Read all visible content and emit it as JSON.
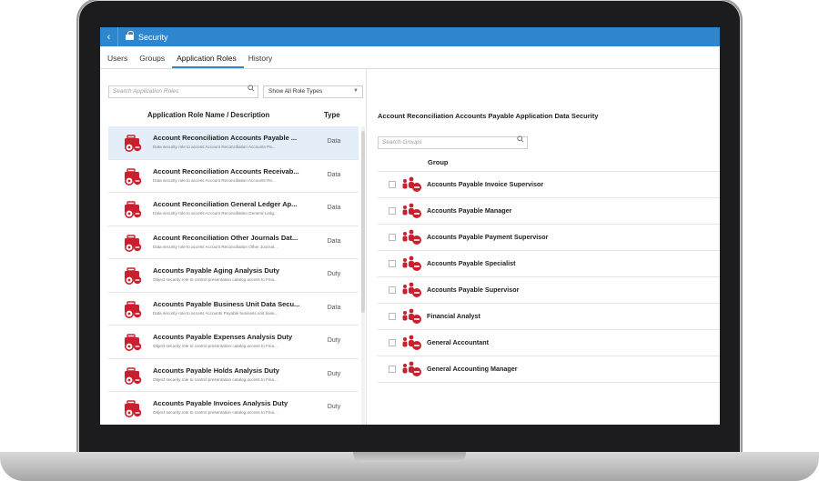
{
  "header": {
    "title": "Security",
    "back_glyph": "‹"
  },
  "tabs": [
    {
      "label": "Users",
      "active": false
    },
    {
      "label": "Groups",
      "active": false
    },
    {
      "label": "Application Roles",
      "active": true
    },
    {
      "label": "History",
      "active": false
    }
  ],
  "left_panel": {
    "search_placeholder": "Search Application Roles",
    "filter_value": "Show All Role Types",
    "columns": {
      "name": "Application Role Name / Description",
      "type": "Type"
    },
    "roles": [
      {
        "name": "Account Reconciliation Accounts Payable ...",
        "desc": "Data security role to access Account Reconciliation Accounts Pa...",
        "type": "Data",
        "selected": true
      },
      {
        "name": "Account Reconciliation Accounts Receivab...",
        "desc": "Data security role to access Account Reconciliation Accounts Re...",
        "type": "Data",
        "selected": false
      },
      {
        "name": "Account Reconciliation General Ledger Ap...",
        "desc": "Data security role to access Account Reconciliation General Ledg...",
        "type": "Data",
        "selected": false
      },
      {
        "name": "Account Reconciliation Other Journals Dat...",
        "desc": "Data security role to access Account Reconciliation Other Journal...",
        "type": "Data",
        "selected": false
      },
      {
        "name": "Accounts Payable Aging Analysis Duty",
        "desc": "Object security role to control presentation catalog access to Fina...",
        "type": "Duty",
        "selected": false
      },
      {
        "name": "Accounts Payable Business Unit Data Secu...",
        "desc": "Data security role to access Accounts Payable business unit base...",
        "type": "Data",
        "selected": false
      },
      {
        "name": "Accounts Payable Expenses Analysis Duty",
        "desc": "Object security role to control presentation catalog access to Fina...",
        "type": "Duty",
        "selected": false
      },
      {
        "name": "Accounts Payable Holds Analysis Duty",
        "desc": "Object security role to control presentation catalog access to Fina...",
        "type": "Duty",
        "selected": false
      },
      {
        "name": "Accounts Payable Invoices Analysis Duty",
        "desc": "Object security role to control presentation catalog access to Fina...",
        "type": "Duty",
        "selected": false
      }
    ]
  },
  "right_panel": {
    "title": "Account Reconciliation Accounts Payable Application Data Security",
    "search_placeholder": "Search Groups",
    "group_column": "Group",
    "groups": [
      "Accounts Payable Invoice Supervisor",
      "Accounts Payable Manager",
      "Accounts Payable Payment Supervisor",
      "Accounts Payable Specialist",
      "Accounts Payable Supervisor",
      "Financial Analyst",
      "General Accountant",
      "General Accounting Manager"
    ]
  },
  "icons": {
    "search": "search-icon",
    "role": "role-briefcase-icon",
    "group": "group-people-icon",
    "accent_color": "#2e86cf",
    "icon_red": "#c8202e"
  }
}
